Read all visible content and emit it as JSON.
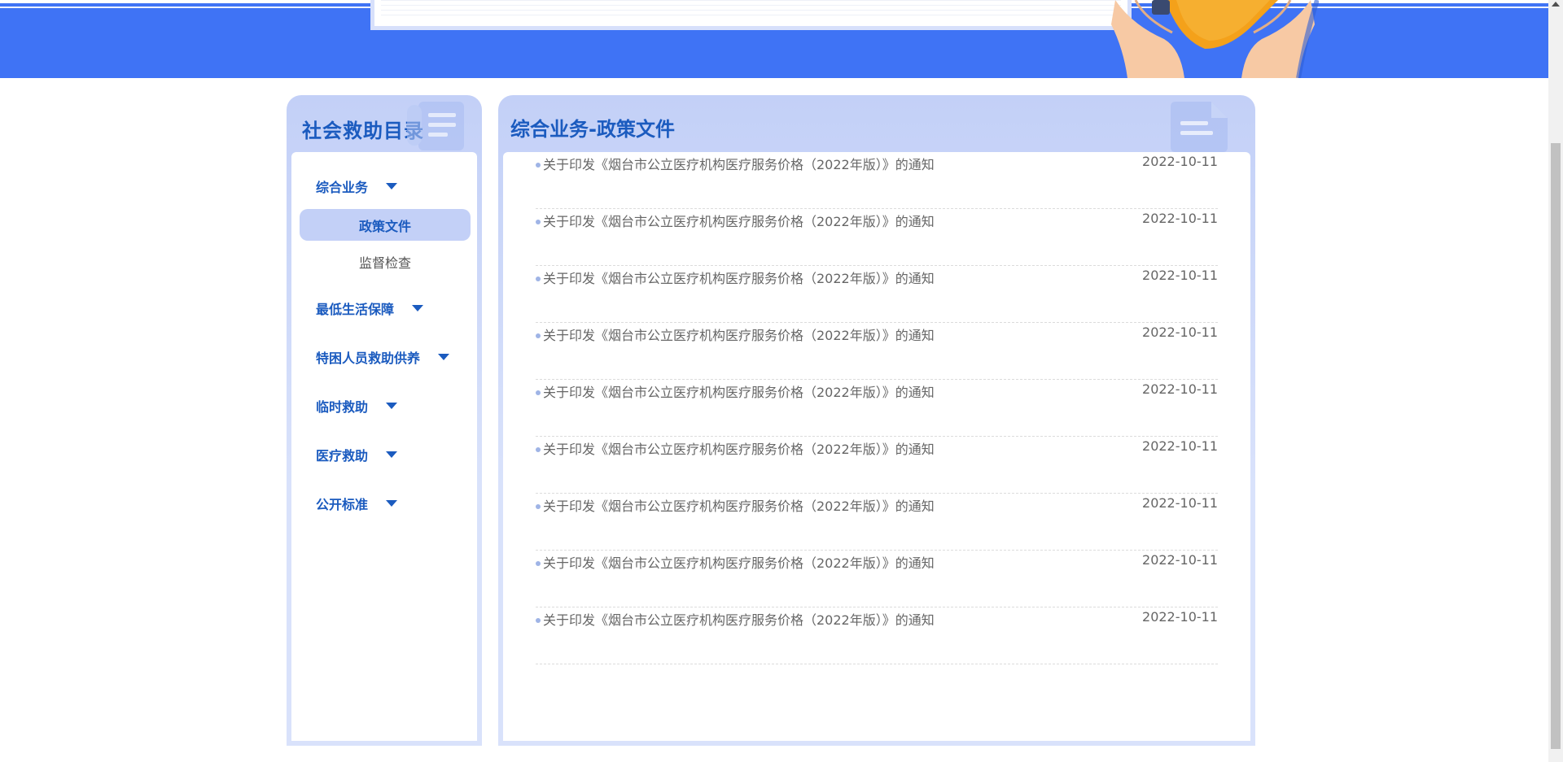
{
  "sidebar": {
    "title": "社会救助目录",
    "groups": [
      {
        "label": "综合业务",
        "children": [
          {
            "label": "政策文件",
            "active": true
          },
          {
            "label": "监督检查",
            "active": false
          }
        ]
      },
      {
        "label": "最低生活保障"
      },
      {
        "label": "特困人员救助供养"
      },
      {
        "label": "临时救助"
      },
      {
        "label": "医疗救助"
      },
      {
        "label": "公开标准"
      }
    ]
  },
  "content": {
    "title": "综合业务-政策文件",
    "documents": [
      {
        "title": "关于印发《烟台市公立医疗机构医疗服务价格（2022年版）》的通知",
        "date": "2022-10-11"
      },
      {
        "title": "关于印发《烟台市公立医疗机构医疗服务价格（2022年版）》的通知",
        "date": "2022-10-11"
      },
      {
        "title": "关于印发《烟台市公立医疗机构医疗服务价格（2022年版）》的通知",
        "date": "2022-10-11"
      },
      {
        "title": "关于印发《烟台市公立医疗机构医疗服务价格（2022年版）》的通知",
        "date": "2022-10-11"
      },
      {
        "title": "关于印发《烟台市公立医疗机构医疗服务价格（2022年版）》的通知",
        "date": "2022-10-11"
      },
      {
        "title": "关于印发《烟台市公立医疗机构医疗服务价格（2022年版）》的通知",
        "date": "2022-10-11"
      },
      {
        "title": "关于印发《烟台市公立医疗机构医疗服务价格（2022年版）》的通知",
        "date": "2022-10-11"
      },
      {
        "title": "关于印发《烟台市公立医疗机构医疗服务价格（2022年版）》的通知",
        "date": "2022-10-11"
      },
      {
        "title": "关于印发《烟台市公立医疗机构医疗服务价格（2022年版）》的通知",
        "date": "2022-10-11"
      }
    ]
  },
  "colors": {
    "banner": "#3f73f5",
    "accent": "#1b5bbf",
    "panel": "#c3d0f7"
  },
  "icons": {
    "banner": "hands-holding-heart-icon",
    "sidebar_deco": "document-list-icon",
    "content_deco": "file-icon"
  }
}
